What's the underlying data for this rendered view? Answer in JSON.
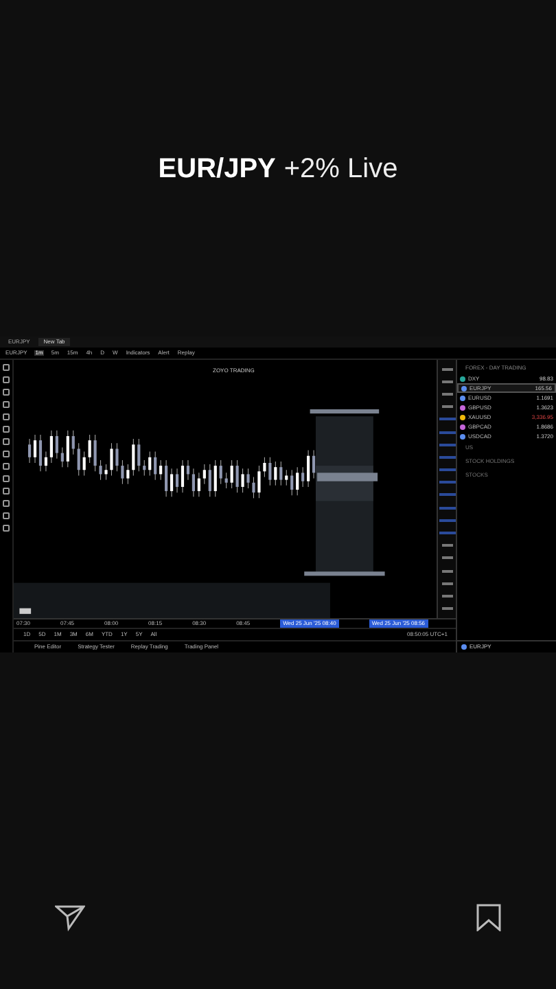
{
  "header": {
    "title": "EUR/JPY",
    "subtitle": "+2% Live"
  },
  "app": {
    "tabs": [
      {
        "label": "EURJPY",
        "selected": false
      },
      {
        "label": "New Tab",
        "selected": true
      }
    ],
    "symbol": "EURJPY",
    "intervals": [
      {
        "label": "1m",
        "selected": true
      },
      {
        "label": "5m",
        "selected": false
      },
      {
        "label": "15m",
        "selected": false
      },
      {
        "label": "4h",
        "selected": false
      },
      {
        "label": "D",
        "selected": false
      },
      {
        "label": "W",
        "selected": false
      }
    ],
    "toolbar": [
      "Indicators",
      "Alert",
      "Replay"
    ],
    "chart_title": "ZOYO TRADING",
    "watchlist": {
      "header": "FOREX - DAY TRADING",
      "rows": [
        {
          "symbol": "DXY",
          "value": "98.83",
          "color": "#26a69a",
          "selected": false,
          "negative": false
        },
        {
          "symbol": "EURJPY",
          "value": "165.56",
          "color": "#5b8def",
          "selected": true,
          "negative": false
        },
        {
          "symbol": "EURUSD",
          "value": "1.1691",
          "color": "#5b8def",
          "selected": false,
          "negative": false
        },
        {
          "symbol": "GBPUSD",
          "value": "1.3623",
          "color": "#c565d8",
          "selected": false,
          "negative": false
        },
        {
          "symbol": "XAUUSD",
          "value": "3,336.95",
          "color": "#f0b90b",
          "selected": false,
          "negative": true
        },
        {
          "symbol": "GBPCAD",
          "value": "1.8686",
          "color": "#c565d8",
          "selected": false,
          "negative": false
        },
        {
          "symbol": "USDCAD",
          "value": "1.3720",
          "color": "#5b8def",
          "selected": false,
          "negative": false
        }
      ],
      "groups": [
        "US",
        "STOCK HOLDINGS",
        "STOCKS"
      ]
    },
    "time_labels": [
      "07:30",
      "07:45",
      "08:00",
      "08:15",
      "08:30",
      "08:45"
    ],
    "time_marks": [
      "Wed 25 Jun '25 08:40",
      "Wed 25 Jun '25 08:56"
    ],
    "timeframes": [
      "1D",
      "5D",
      "1M",
      "3M",
      "6M",
      "YTD",
      "1Y",
      "5Y",
      "All"
    ],
    "clock": "08:50:05 UTC+1",
    "bottom_tabs": [
      "Pine Editor",
      "Strategy Tester",
      "Replay Trading",
      "Trading Panel"
    ],
    "details_symbol": "EURJPY"
  }
}
